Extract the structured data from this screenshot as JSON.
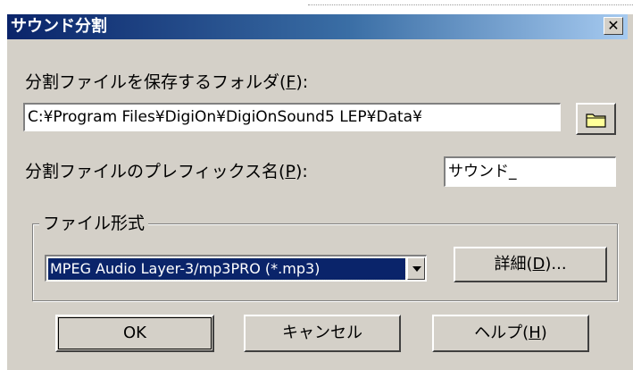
{
  "window": {
    "title": "サウンド分割",
    "close_glyph": "✕"
  },
  "folder": {
    "label_pre": "分割ファイルを保存するフォルダ(",
    "label_key": "F",
    "label_post": "):",
    "value": "C:¥Program Files¥DigiOn¥DigiOnSound5 LEP¥Data¥",
    "browse_icon": "folder-icon"
  },
  "prefix": {
    "label_pre": "分割ファイルのプレフィックス名(",
    "label_key": "P",
    "label_post": "):",
    "value": "サウンド_"
  },
  "format": {
    "group_label": "ファイル形式",
    "selected": "MPEG Audio Layer-3/mp3PRO (*.mp3)",
    "details_pre": "詳細(",
    "details_key": "D",
    "details_post": ")..."
  },
  "buttons": {
    "ok": "OK",
    "cancel": "キャンセル",
    "help_pre": "ヘルプ(",
    "help_key": "H",
    "help_post": ")"
  },
  "colors": {
    "titlebar_start": "#0a246a",
    "titlebar_end": "#a6caf0",
    "face": "#d4d0c8",
    "selection": "#0a246a"
  }
}
